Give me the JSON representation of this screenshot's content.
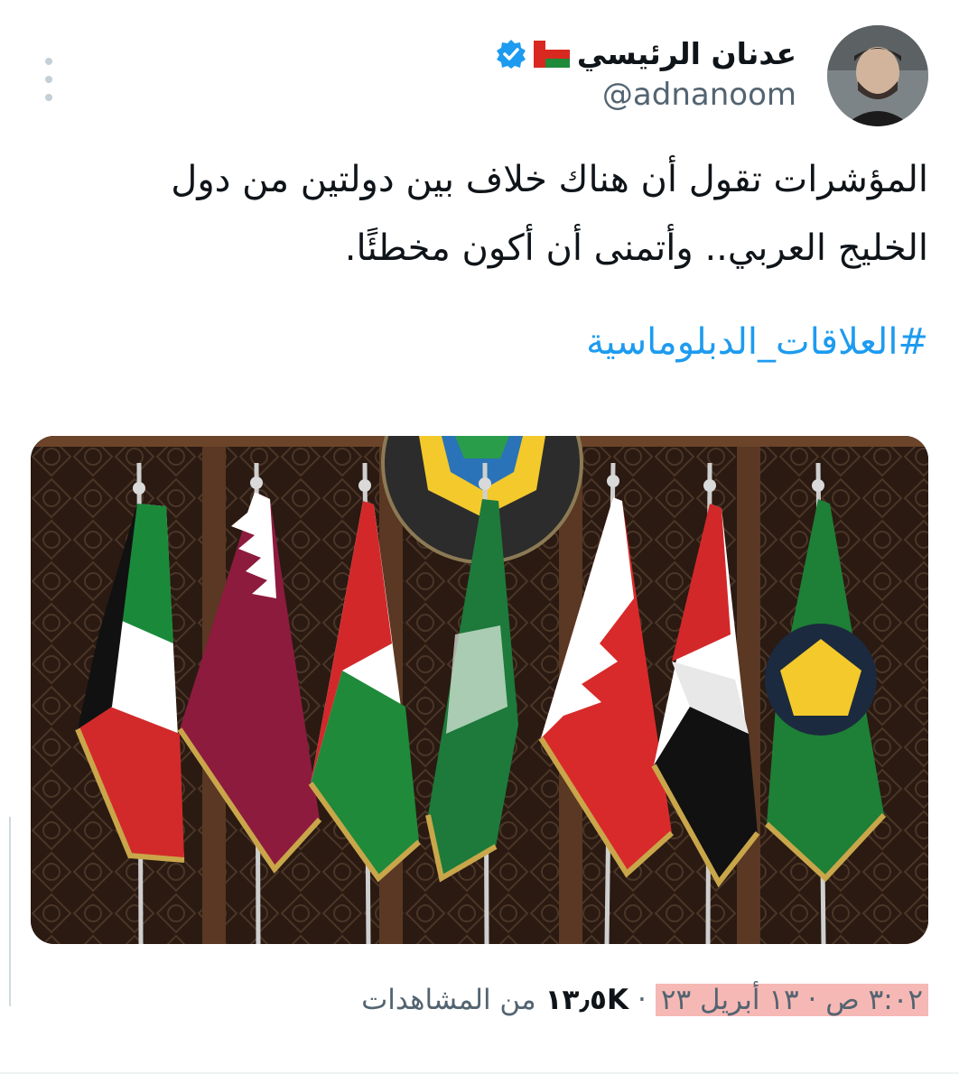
{
  "author": {
    "display_name": "عدنان الرئيسي",
    "handle": "@adnanoom",
    "flag_icon": "oman-flag-emoji",
    "verified_icon": "verified-badge-icon",
    "verified_color": "#1d9bf0"
  },
  "tweet": {
    "line1": "المؤشرات تقول أن هناك خلاف بين دولتين من دول",
    "line2": "الخليج العربي.. وأتمنى أن أكون مخطئًا.",
    "hashtag": "#العلاقات_الدبلوماسية"
  },
  "media": {
    "description_icon": "gcc-flags-photo"
  },
  "meta": {
    "time": "٣:٠٢ ص",
    "sep": "·",
    "date": "١٣ أبريل ٢٣",
    "views_count": "١٣٫٥K",
    "views_label": "من المشاهدات"
  },
  "colors": {
    "link": "#1d9bf0",
    "secondary": "#536471",
    "highlight": "#f6b8b4"
  }
}
